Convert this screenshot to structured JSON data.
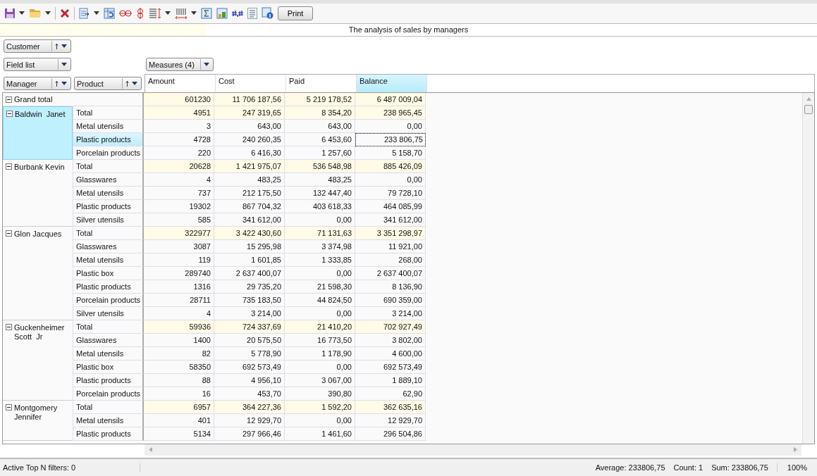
{
  "toolbar": {
    "print_label": "Print"
  },
  "report_title": "The analysis of sales by managers",
  "page_fields": [
    {
      "label": "Customer",
      "sortable": true
    }
  ],
  "field_list": {
    "label": "Field list",
    "sortable": false
  },
  "measures_button": {
    "label": "Measures (4)",
    "sortable": false
  },
  "row_fields": [
    {
      "label": "Manager",
      "sortable": true
    },
    {
      "label": "Product",
      "sortable": true
    }
  ],
  "columns": [
    {
      "label": "Amount",
      "selected": false
    },
    {
      "label": "Cost",
      "selected": false
    },
    {
      "label": "Paid",
      "selected": false
    },
    {
      "label": "Balance",
      "selected": true
    }
  ],
  "grand_total": {
    "label": "Grand total",
    "expanded": true,
    "values": [
      "601230",
      "11 706 187,56",
      "5 219 178,52",
      "6 487 009,04"
    ]
  },
  "managers": [
    {
      "name": "Baldwin  Janet",
      "expanded": true,
      "selected": true,
      "rows": [
        {
          "kind": "total",
          "product": "Total",
          "selected": false,
          "focused": false,
          "values": [
            "4951",
            "247 319,65",
            "8 354,20",
            "238 965,45"
          ]
        },
        {
          "kind": "item",
          "product": "Metal utensils",
          "selected": false,
          "focused": false,
          "values": [
            "3",
            "643,00",
            "643,00",
            "0,00"
          ]
        },
        {
          "kind": "item",
          "product": "Plastic products",
          "selected": true,
          "focused": true,
          "values": [
            "4728",
            "240 260,35",
            "6 453,60",
            "233 806,75"
          ]
        },
        {
          "kind": "item",
          "product": "Porcelain products",
          "selected": false,
          "focused": false,
          "values": [
            "220",
            "6 416,30",
            "1 257,60",
            "5 158,70"
          ]
        }
      ]
    },
    {
      "name": "Burbank Kevin",
      "expanded": true,
      "selected": false,
      "rows": [
        {
          "kind": "total",
          "product": "Total",
          "selected": false,
          "focused": false,
          "values": [
            "20628",
            "1 421 975,07",
            "536 548,98",
            "885 426,09"
          ]
        },
        {
          "kind": "item",
          "product": "Glasswares",
          "selected": false,
          "focused": false,
          "values": [
            "4",
            "483,25",
            "483,25",
            "0,00"
          ]
        },
        {
          "kind": "item",
          "product": "Metal utensils",
          "selected": false,
          "focused": false,
          "values": [
            "737",
            "212 175,50",
            "132 447,40",
            "79 728,10"
          ]
        },
        {
          "kind": "item",
          "product": "Plastic products",
          "selected": false,
          "focused": false,
          "values": [
            "19302",
            "867 704,32",
            "403 618,33",
            "464 085,99"
          ]
        },
        {
          "kind": "item",
          "product": "Silver utensils",
          "selected": false,
          "focused": false,
          "values": [
            "585",
            "341 612,00",
            "0,00",
            "341 612,00"
          ]
        }
      ]
    },
    {
      "name": "Glon Jacques",
      "expanded": true,
      "selected": false,
      "rows": [
        {
          "kind": "total",
          "product": "Total",
          "selected": false,
          "focused": false,
          "values": [
            "322977",
            "3 422 430,60",
            "71 131,63",
            "3 351 298,97"
          ]
        },
        {
          "kind": "item",
          "product": "Glasswares",
          "selected": false,
          "focused": false,
          "values": [
            "3087",
            "15 295,98",
            "3 374,98",
            "11 921,00"
          ]
        },
        {
          "kind": "item",
          "product": "Metal utensils",
          "selected": false,
          "focused": false,
          "values": [
            "119",
            "1 601,85",
            "1 333,85",
            "268,00"
          ]
        },
        {
          "kind": "item",
          "product": "Plastic box",
          "selected": false,
          "focused": false,
          "values": [
            "289740",
            "2 637 400,07",
            "0,00",
            "2 637 400,07"
          ]
        },
        {
          "kind": "item",
          "product": "Plastic products",
          "selected": false,
          "focused": false,
          "values": [
            "1316",
            "29 735,20",
            "21 598,30",
            "8 136,90"
          ]
        },
        {
          "kind": "item",
          "product": "Porcelain products",
          "selected": false,
          "focused": false,
          "values": [
            "28711",
            "735 183,50",
            "44 824,50",
            "690 359,00"
          ]
        },
        {
          "kind": "item",
          "product": "Silver utensils",
          "selected": false,
          "focused": false,
          "values": [
            "4",
            "3 214,00",
            "0,00",
            "3 214,00"
          ]
        }
      ]
    },
    {
      "name": "Guckenheimer Scott  Jr",
      "expanded": true,
      "selected": false,
      "rows": [
        {
          "kind": "total",
          "product": "Total",
          "selected": false,
          "focused": false,
          "values": [
            "59936",
            "724 337,69",
            "21 410,20",
            "702 927,49"
          ]
        },
        {
          "kind": "item",
          "product": "Glasswares",
          "selected": false,
          "focused": false,
          "values": [
            "1400",
            "20 575,50",
            "16 773,50",
            "3 802,00"
          ]
        },
        {
          "kind": "item",
          "product": "Metal utensils",
          "selected": false,
          "focused": false,
          "values": [
            "82",
            "5 778,90",
            "1 178,90",
            "4 600,00"
          ]
        },
        {
          "kind": "item",
          "product": "Plastic box",
          "selected": false,
          "focused": false,
          "values": [
            "58350",
            "692 573,49",
            "0,00",
            "692 573,49"
          ]
        },
        {
          "kind": "item",
          "product": "Plastic products",
          "selected": false,
          "focused": false,
          "values": [
            "88",
            "4 956,10",
            "3 067,00",
            "1 889,10"
          ]
        },
        {
          "kind": "item",
          "product": "Porcelain products",
          "selected": false,
          "focused": false,
          "values": [
            "16",
            "453,70",
            "390,80",
            "62,90"
          ]
        }
      ]
    },
    {
      "name": "Montgomery Jennifer",
      "expanded": true,
      "selected": false,
      "rows": [
        {
          "kind": "total",
          "product": "Total",
          "selected": false,
          "focused": false,
          "values": [
            "6957",
            "364 227,36",
            "1 592,20",
            "362 635,16"
          ]
        },
        {
          "kind": "item",
          "product": "Metal utensils",
          "selected": false,
          "focused": false,
          "values": [
            "401",
            "12 929,70",
            "0,00",
            "12 929,70"
          ]
        },
        {
          "kind": "item",
          "product": "Plastic products",
          "selected": false,
          "focused": false,
          "values": [
            "5134",
            "297 966,46",
            "1 461,60",
            "296 504,86"
          ]
        }
      ]
    }
  ],
  "status_bar": {
    "filters": "Active Top N filters: 0",
    "average": "Average: 233806,75",
    "count": "Count: 1",
    "sum": "Sum: 233806,75",
    "zoom": "100%"
  }
}
